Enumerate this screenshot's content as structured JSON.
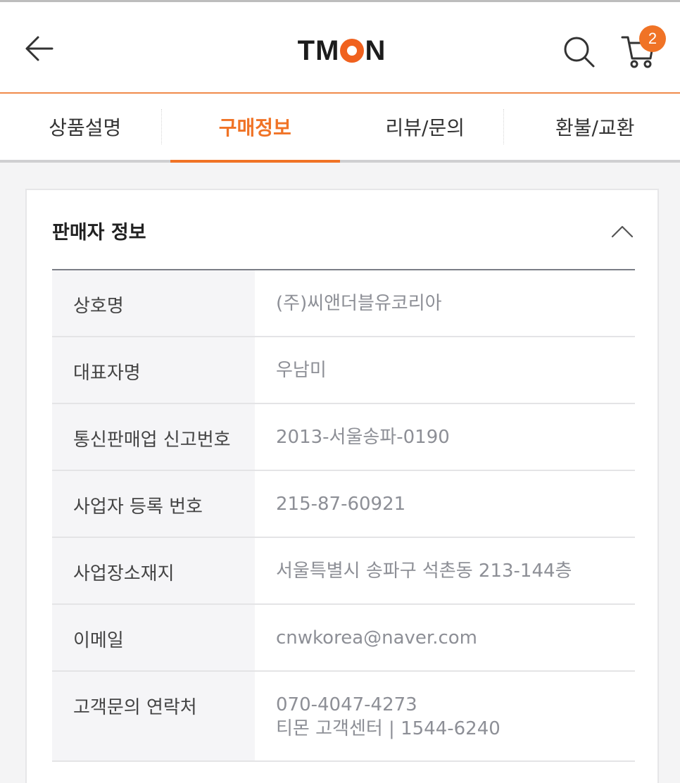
{
  "header": {
    "logo": "TMON",
    "cart_count": "2",
    "icons": {
      "back": "arrow-left-icon",
      "search": "search-icon",
      "cart": "cart-icon",
      "collapse": "chevron-up-icon"
    },
    "accent_color": "#f07326"
  },
  "tabs": [
    {
      "label": "상품설명",
      "active": false
    },
    {
      "label": "구매정보",
      "active": true
    },
    {
      "label": "리뷰/문의",
      "active": false
    },
    {
      "label": "환불/교환",
      "active": false
    }
  ],
  "seller_info": {
    "title": "판매자 정보",
    "rows": [
      {
        "label": "상호명",
        "value": "(주)씨앤더블유코리아"
      },
      {
        "label": "대표자명",
        "value": "우남미"
      },
      {
        "label": "통신판매업 신고번호",
        "value": "2013-서울송파-0190"
      },
      {
        "label": "사업자 등록 번호",
        "value": "215-87-60921"
      },
      {
        "label": "사업장소재지",
        "value": "서울특별시 송파구 석촌동 213-144층"
      },
      {
        "label": "이메일",
        "value": "cnwkorea@naver.com"
      },
      {
        "label": "고객문의 연락처",
        "value": "070-4047-4273",
        "value2": "티몬 고객센터 | 1544-6240"
      }
    ]
  }
}
